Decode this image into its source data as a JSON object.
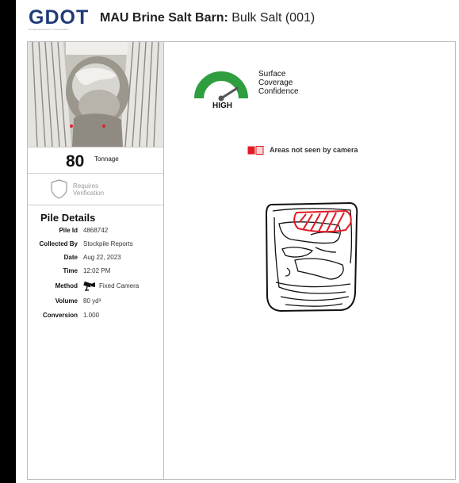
{
  "header": {
    "logo_text": "GDOT",
    "logo_subtitle": "Georgia Department of Transportation",
    "title_bold": "MAU Brine Salt Barn:",
    "title_rest": "Bulk Salt (001)"
  },
  "summary": {
    "tonnage_value": "80",
    "tonnage_label": "Tonnage",
    "verification_line1": "Requires",
    "verification_line2": "Verification"
  },
  "pile_details": {
    "title": "Pile Details",
    "rows": [
      {
        "label": "Pile Id",
        "value": "4868742"
      },
      {
        "label": "Collected By",
        "value": "Stockpile Reports"
      },
      {
        "label": "Date",
        "value": "Aug 22, 2023"
      },
      {
        "label": "Time",
        "value": "12:02 PM"
      },
      {
        "label": "Method",
        "value": "Fixed Camera",
        "icon": "security-camera-icon"
      },
      {
        "label": "Volume",
        "value": "80 yd³"
      },
      {
        "label": "Conversion",
        "value": "1.000"
      }
    ]
  },
  "coverage": {
    "level": "HIGH",
    "label_line1": "Surface",
    "label_line2": "Coverage",
    "label_line3": "Confidence",
    "gauge_fraction": 0.82,
    "gauge_color": "#2e9e3e"
  },
  "legend": {
    "text": "Areas not seen by camera",
    "swatch_color": "#e01b24"
  },
  "colors": {
    "brand": "#1f3c78",
    "unseen_area": "#e01b24"
  }
}
